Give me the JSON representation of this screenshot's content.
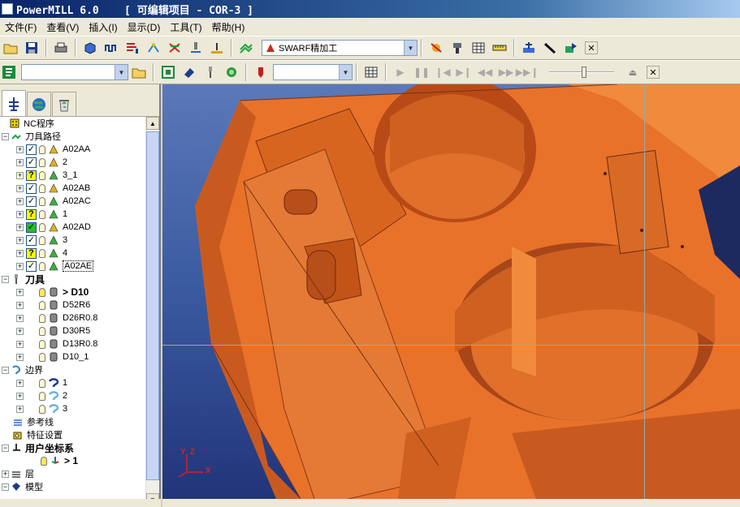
{
  "title": "PowerMILL 6.0    [ 可编辑项目 - COR-3 ]",
  "menu": [
    "文件(F)",
    "查看(V)",
    "插入(I)",
    "显示(D)",
    "工具(T)",
    "帮助(H)"
  ],
  "toolbar1": {
    "strategy_combo": "SWARF精加工"
  },
  "toolbar2": {
    "combo1": "",
    "combo2": ""
  },
  "tree": {
    "nc_programs": "NC程序",
    "toolpaths": "刀具路径",
    "toolpath_items": [
      {
        "label": "A02AA",
        "state": "check"
      },
      {
        "label": "2",
        "state": "check"
      },
      {
        "label": "3_1",
        "state": "question"
      },
      {
        "label": "A02AB",
        "state": "check"
      },
      {
        "label": "A02AC",
        "state": "check"
      },
      {
        "label": "1",
        "state": "question"
      },
      {
        "label": "A02AD",
        "state": "green"
      },
      {
        "label": "3",
        "state": "check"
      },
      {
        "label": "4",
        "state": "question"
      },
      {
        "label": "A02AE",
        "state": "check"
      }
    ],
    "tools": "刀具",
    "tool_items": [
      "> D10",
      "D52R6",
      "D26R0.8",
      "D30R5",
      "D13R0.8",
      "D10_1"
    ],
    "boundaries": "边界",
    "boundary_items": [
      "1",
      "2",
      "3"
    ],
    "patterns": "参考线",
    "features": "特征设置",
    "workplanes": "用户坐标系",
    "workplane_items": [
      "> 1"
    ],
    "levels": "层",
    "models": "模型"
  },
  "viewport": {
    "axis_labels": {
      "x": "X",
      "y": "Y",
      "z": "Z"
    }
  },
  "colors": {
    "model_orange": "#e8722a",
    "model_shadow": "#a8461a",
    "background_top": "#5b78b8",
    "background_bottom": "#22347a"
  }
}
